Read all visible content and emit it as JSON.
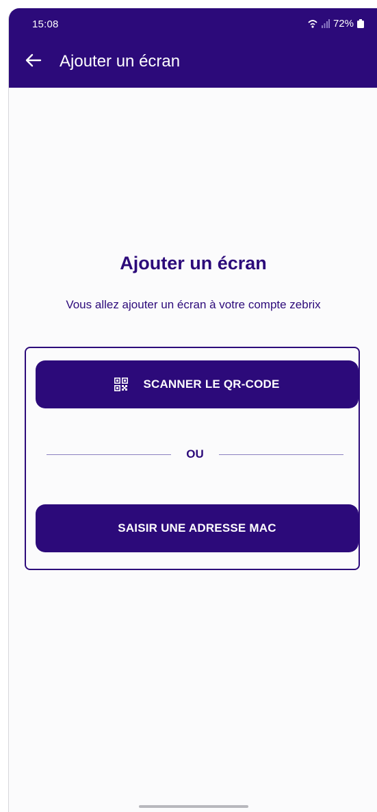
{
  "status_bar": {
    "time": "15:08",
    "battery": "72%"
  },
  "app_bar": {
    "back_icon": "arrow-left-icon",
    "title": "Ajouter un écran"
  },
  "content": {
    "heading": "Ajouter un écran",
    "subtitle": "Vous allez ajouter un écran à votre compte zebrix"
  },
  "card": {
    "scan_button_label": "SCANNER LE QR-CODE",
    "scan_button_icon": "qr-code-icon",
    "divider_label": "OU",
    "mac_button_label": "SAISIR UNE ADRESSE MAC"
  },
  "colors": {
    "primary": "#2c0a7a",
    "background": "#fbfbfc",
    "on_primary": "#ffffff"
  }
}
